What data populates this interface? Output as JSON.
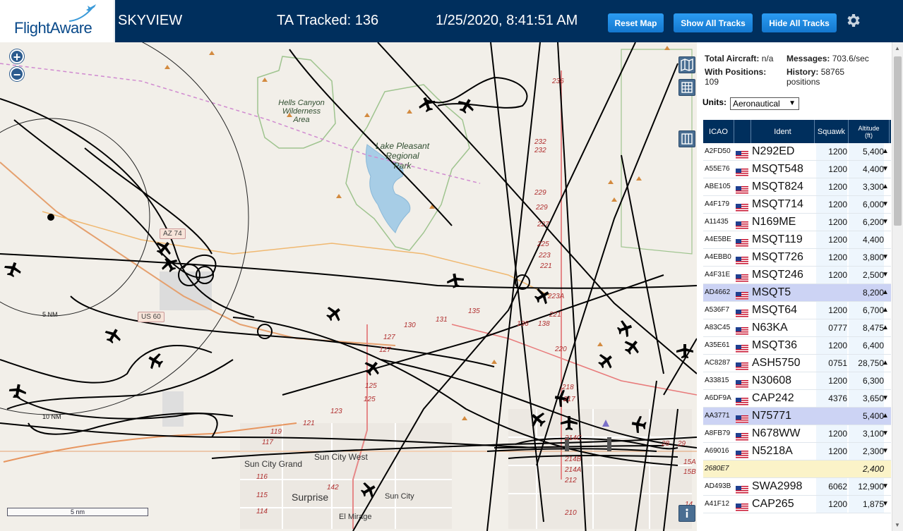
{
  "header": {
    "logo_text": "FlightAware",
    "app_title": "SKYVIEW",
    "tracked_text": "TA Tracked: 136",
    "datetime": "1/25/2020, 8:41:51 AM",
    "buttons": {
      "reset_map": "Reset Map",
      "show_all": "Show All Tracks",
      "hide_all": "Hide All Tracks"
    },
    "settings_icon": "gear-icon"
  },
  "map": {
    "zoom_in": "+",
    "zoom_out": "−",
    "scale_label": "5 nm",
    "range_labels": {
      "inner": "5 NM",
      "outer": "10 NM"
    },
    "areas": {
      "hells_canyon": [
        "Hells Canyon",
        "Wilderness",
        "Area"
      ],
      "lake_pleasant": [
        "Lake Pleasant",
        "Regional",
        "Park"
      ]
    },
    "shields": {
      "az74": "AZ 74",
      "us60": "US 60"
    },
    "cities": {
      "sun_city_grand": "Sun City Grand",
      "sun_city_west": "Sun City West",
      "surprise": "Surprise",
      "sun_city": "Sun City",
      "el_mirage": "El Mirage"
    },
    "road_numbers": [
      "236",
      "232",
      "232",
      "229",
      "229",
      "227",
      "225",
      "223",
      "221",
      "223A",
      "221",
      "220",
      "218",
      "217",
      "214C",
      "214B",
      "214A",
      "212",
      "210",
      "131",
      "130",
      "135",
      "136",
      "138",
      "127",
      "127",
      "125",
      "125",
      "123",
      "121",
      "119",
      "117",
      "116",
      "115",
      "114",
      "142",
      "28",
      "29",
      "15A",
      "15B",
      "14"
    ],
    "controls": {
      "map_icon": "map-icon",
      "grid_icon": "grid-icon",
      "columns_icon": "columns-icon",
      "info_icon": "info-icon"
    }
  },
  "sidebar": {
    "stats": {
      "total_label": "Total Aircraft:",
      "total_value": "n/a",
      "messages_label": "Messages:",
      "messages_value": "703.6/sec",
      "positions_label": "With Positions:",
      "positions_value": "109",
      "history_label": "History:",
      "history_value": "58765",
      "history_unit": "positions"
    },
    "units_label": "Units:",
    "units_value": "Aeronautical",
    "table": {
      "headers": {
        "icao": "ICAO",
        "ident": "Ident",
        "squawk": "Squawk",
        "altitude": "Altitude",
        "altitude_unit": "(ft)"
      },
      "rows": [
        {
          "icao": "A2FD50",
          "ident": "N292ED",
          "squawk": "1200",
          "alt": "5,400",
          "dir": "▲",
          "style": ""
        },
        {
          "icao": "A55E76",
          "ident": "MSQT548",
          "squawk": "1200",
          "alt": "4,400",
          "dir": "▼",
          "style": ""
        },
        {
          "icao": "ABE105",
          "ident": "MSQT824",
          "squawk": "1200",
          "alt": "3,300",
          "dir": "▲",
          "style": ""
        },
        {
          "icao": "A4F179",
          "ident": "MSQT714",
          "squawk": "1200",
          "alt": "6,000",
          "dir": "▼",
          "style": ""
        },
        {
          "icao": "A11435",
          "ident": "N169ME",
          "squawk": "1200",
          "alt": "6,200",
          "dir": "▼",
          "style": ""
        },
        {
          "icao": "A4E5BE",
          "ident": "MSQT119",
          "squawk": "1200",
          "alt": "4,400",
          "dir": "",
          "style": ""
        },
        {
          "icao": "A4EBB0",
          "ident": "MSQT726",
          "squawk": "1200",
          "alt": "3,800",
          "dir": "▼",
          "style": ""
        },
        {
          "icao": "A4F31E",
          "ident": "MSQT246",
          "squawk": "1200",
          "alt": "2,500",
          "dir": "▼",
          "style": ""
        },
        {
          "icao": "AD4662",
          "ident": "MSQT5",
          "squawk": "",
          "alt": "8,200",
          "dir": "▲",
          "style": "sel"
        },
        {
          "icao": "A536F7",
          "ident": "MSQT64",
          "squawk": "1200",
          "alt": "6,700",
          "dir": "▲",
          "style": ""
        },
        {
          "icao": "A83C45",
          "ident": "N63KA",
          "squawk": "0777",
          "alt": "8,475",
          "dir": "▲",
          "style": ""
        },
        {
          "icao": "A35E61",
          "ident": "MSQT36",
          "squawk": "1200",
          "alt": "6,400",
          "dir": "",
          "style": ""
        },
        {
          "icao": "AC8287",
          "ident": "ASH5750",
          "squawk": "0751",
          "alt": "28,750",
          "dir": "▲",
          "style": ""
        },
        {
          "icao": "A33815",
          "ident": "N30608",
          "squawk": "1200",
          "alt": "6,300",
          "dir": "",
          "style": ""
        },
        {
          "icao": "A6DF9A",
          "ident": "CAP242",
          "squawk": "4376",
          "alt": "3,650",
          "dir": "▼",
          "style": ""
        },
        {
          "icao": "AA3771",
          "ident": "N75771",
          "squawk": "",
          "alt": "5,400",
          "dir": "▲",
          "style": "sel"
        },
        {
          "icao": "A8FB79",
          "ident": "N678WW",
          "squawk": "1200",
          "alt": "3,100",
          "dir": "▼",
          "style": ""
        },
        {
          "icao": "A69016",
          "ident": "N5218A",
          "squawk": "1200",
          "alt": "2,300",
          "dir": "▼",
          "style": ""
        },
        {
          "icao": "2680E7",
          "ident": "",
          "squawk": "",
          "alt": "2,400",
          "dir": "",
          "style": "alt",
          "flag": false
        },
        {
          "icao": "AD493B",
          "ident": "SWA2998",
          "squawk": "6062",
          "alt": "12,900",
          "dir": "▼",
          "style": ""
        },
        {
          "icao": "A41F12",
          "ident": "CAP265",
          "squawk": "1200",
          "alt": "1,875",
          "dir": "▼",
          "style": ""
        }
      ]
    }
  },
  "colors": {
    "header_bg": "#002f5d",
    "button": "#1e88e5",
    "map_bg": "#f2efe9",
    "lake": "#a7cde6",
    "track": "#000000"
  }
}
